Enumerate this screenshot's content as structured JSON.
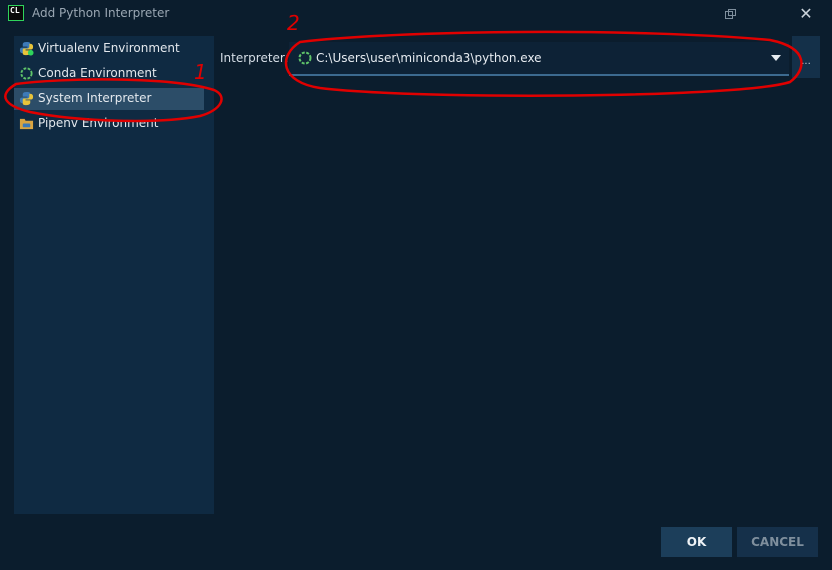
{
  "window": {
    "app_logo_text": "CL",
    "title": "Add Python Interpreter",
    "close_icon": "close-icon",
    "restore_icon": "restore-icon"
  },
  "sidebar": {
    "items": [
      {
        "label": "Virtualenv Environment",
        "icon": "virtualenv-icon",
        "selected": false
      },
      {
        "label": "Conda Environment",
        "icon": "conda-icon",
        "selected": false
      },
      {
        "label": "System Interpreter",
        "icon": "python-icon",
        "selected": true
      },
      {
        "label": "Pipenv Environment",
        "icon": "pipenv-icon",
        "selected": false
      }
    ]
  },
  "main": {
    "interpreter_label": "Interpreter:",
    "interpreter_value": "C:\\Users\\user\\miniconda3\\python.exe",
    "browse_label": "..."
  },
  "buttons": {
    "ok": "OK",
    "cancel": "CANCEL"
  },
  "annotations": {
    "marker_1": "1",
    "marker_2": "2",
    "color": "#e00000"
  },
  "colors": {
    "background": "#0b1d2d",
    "panel": "#0f2a42",
    "selection": "#2c4d68",
    "accent_green": "#2fd45b"
  }
}
